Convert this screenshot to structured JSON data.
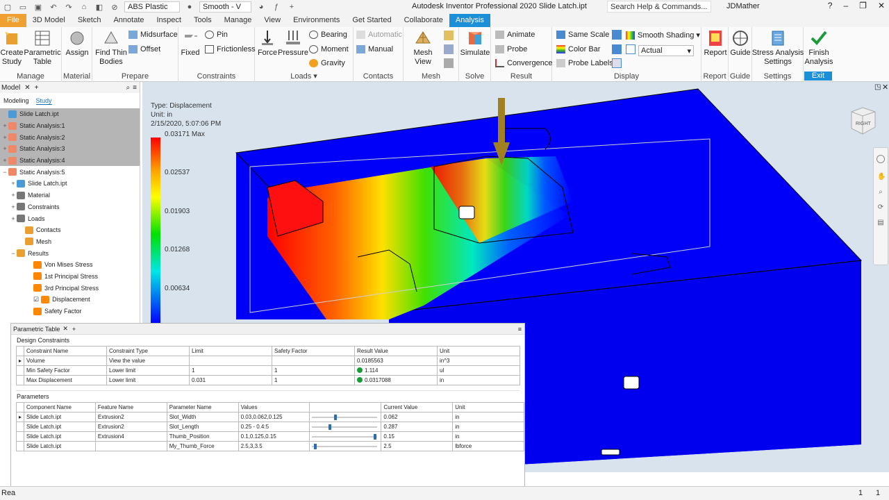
{
  "window": {
    "title": "Autodesk Inventor Professional 2020   Slide Latch.ipt",
    "search_placeholder": "Search Help & Commands...",
    "user": "JDMather",
    "material": "ABS Plastic",
    "visual_style": "Smooth - V"
  },
  "tabs": [
    "File",
    "3D Model",
    "Sketch",
    "Annotate",
    "Inspect",
    "Tools",
    "Manage",
    "View",
    "Environments",
    "Get Started",
    "Collaborate",
    "Analysis"
  ],
  "ribbon": {
    "manage": {
      "label": "Manage",
      "create_study": "Create\nStudy",
      "parametric_table": "Parametric\nTable"
    },
    "material": {
      "label": "Material",
      "assign": "Assign"
    },
    "prepare": {
      "label": "Prepare",
      "find_thin_bodies": "Find Thin\nBodies",
      "midsurface": "Midsurface",
      "offset": "Offset"
    },
    "constraints": {
      "label": "Constraints",
      "fixed": "Fixed",
      "pin": "Pin",
      "frictionless": "Frictionless"
    },
    "loads": {
      "label": "Loads",
      "force": "Force",
      "pressure": "Pressure",
      "bearing": "Bearing",
      "moment": "Moment",
      "gravity": "Gravity"
    },
    "contacts": {
      "label": "Contacts",
      "automatic": "Automatic",
      "manual": "Manual"
    },
    "mesh": {
      "label": "Mesh",
      "mesh_view": "Mesh View"
    },
    "solve": {
      "label": "Solve",
      "simulate": "Simulate"
    },
    "result": {
      "label": "Result",
      "animate": "Animate",
      "probe": "Probe",
      "convergence": "Convergence"
    },
    "display": {
      "label": "Display",
      "same_scale": "Same Scale",
      "color_bar": "Color Bar",
      "probe_labels": "Probe Labels",
      "smooth_shading": "Smooth Shading",
      "actual": "Actual"
    },
    "report": {
      "label": "Report",
      "report": "Report"
    },
    "guide": {
      "label": "Guide",
      "guide": "Guide"
    },
    "settings": {
      "label": "Settings",
      "stress_analysis_settings": "Stress Analysis\nSettings"
    },
    "exit": {
      "label": "Exit",
      "finish_analysis": "Finish\nAnalysis"
    }
  },
  "browser": {
    "tab_model": "Model",
    "sub_modeling": "Modeling",
    "sub_study": "Study",
    "tree": [
      {
        "label": "Slide Latch.ipt",
        "indent": 0,
        "sel": true,
        "pm": "",
        "icon": "#4a9ad8"
      },
      {
        "label": "Static Analysis:1",
        "indent": 0,
        "sel": true,
        "pm": "+",
        "icon": "#e86"
      },
      {
        "label": "Static Analysis:2",
        "indent": 0,
        "sel": true,
        "pm": "+",
        "icon": "#e86"
      },
      {
        "label": "Static Analysis:3",
        "indent": 0,
        "sel": true,
        "pm": "+",
        "icon": "#e86"
      },
      {
        "label": "Static Analysis:4",
        "indent": 0,
        "sel": true,
        "pm": "+",
        "icon": "#e86"
      },
      {
        "label": "Static Analysis:5",
        "indent": 0,
        "sel": false,
        "pm": "−",
        "icon": "#e86"
      },
      {
        "label": "Slide Latch.ipt",
        "indent": 1,
        "sel": false,
        "pm": "+",
        "icon": "#4a9ad8"
      },
      {
        "label": "Material",
        "indent": 1,
        "sel": false,
        "pm": "+",
        "icon": "#777"
      },
      {
        "label": "Constraints",
        "indent": 1,
        "sel": false,
        "pm": "+",
        "icon": "#777"
      },
      {
        "label": "Loads",
        "indent": 1,
        "sel": false,
        "pm": "+",
        "icon": "#777"
      },
      {
        "label": "Contacts",
        "indent": 2,
        "sel": false,
        "pm": "",
        "icon": "#e9a030"
      },
      {
        "label": "Mesh",
        "indent": 2,
        "sel": false,
        "pm": "",
        "icon": "#e9a030"
      },
      {
        "label": "Results",
        "indent": 1,
        "sel": false,
        "pm": "−",
        "icon": "#e9a030"
      },
      {
        "label": "Von Mises Stress",
        "indent": 3,
        "sel": false,
        "pm": "",
        "icon": "#f80"
      },
      {
        "label": "1st Principal Stress",
        "indent": 3,
        "sel": false,
        "pm": "",
        "icon": "#f80"
      },
      {
        "label": "3rd Principal Stress",
        "indent": 3,
        "sel": false,
        "pm": "",
        "icon": "#f80"
      },
      {
        "label": "Displacement",
        "indent": 3,
        "sel": false,
        "pm": "",
        "icon": "#f80",
        "check": true
      },
      {
        "label": "Safety Factor",
        "indent": 3,
        "sel": false,
        "pm": "",
        "icon": "#f80"
      }
    ]
  },
  "legend": {
    "type": "Type: Displacement",
    "unit": "Unit: in",
    "date": "2/15/2020, 5:07:06 PM",
    "values": [
      "0.03171 Max",
      "0.02537",
      "0.01903",
      "0.01268",
      "0.00634"
    ]
  },
  "param_panel": {
    "title": "Parametric Table",
    "design_constraints_label": "Design Constraints",
    "dc_headers": [
      "Constraint Name",
      "Constraint Type",
      "Limit",
      "Safety Factor",
      "Result Value",
      "Unit"
    ],
    "dc_rows": [
      [
        "Volume",
        "View the value",
        "",
        "",
        "0.0185563",
        "in^3"
      ],
      [
        "Min Safety Factor",
        "Lower limit",
        "1",
        "1",
        "1.114",
        "ul"
      ],
      [
        "Max Displacement",
        "Lower limit",
        "0.031",
        "1",
        "0.0317088",
        "in"
      ]
    ],
    "parameters_label": "Parameters",
    "p_headers": [
      "Component Name",
      "Feature Name",
      "Parameter Name",
      "Values",
      "",
      "Current Value",
      "Unit"
    ],
    "p_rows": [
      [
        "Slide Latch.ipt",
        "Extrusion2",
        "Slot_Width",
        "0.03,0.062,0.125",
        "",
        "0.062",
        "in"
      ],
      [
        "Slide Latch.ipt",
        "Extrusion2",
        "Slot_Length",
        "0.25 - 0.4:5",
        "",
        "0.287",
        "in"
      ],
      [
        "Slide Latch.ipt",
        "Extrusion4",
        "Thumb_Position",
        "0.1,0.125,0.15",
        "",
        "0.15",
        "in"
      ],
      [
        "Slide Latch.ipt",
        "",
        "My_Thumb_Force",
        "2.5,3,3.5",
        "",
        "2.5",
        "lbforce"
      ]
    ],
    "slider_positions": [
      0.35,
      0.26,
      0.98,
      0.03
    ]
  },
  "viewcube": {
    "face": "RIGHT"
  },
  "status": {
    "left": "Rea",
    "right1": "1",
    "right2": "1"
  }
}
